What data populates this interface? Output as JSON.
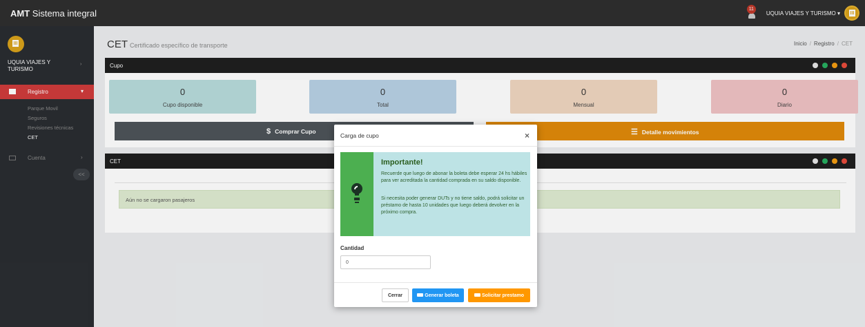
{
  "topbar": {
    "brand_bold": "AMT",
    "brand_rest": " Sistema integral",
    "notif_count": "11",
    "user_name": "UQUIA VIAJES Y TURISMO"
  },
  "sidebar": {
    "user_name": "UQUIA VIAJES Y TURISMO",
    "registro_label": "Registro",
    "sub_items": [
      "Parque Movil",
      "Seguros",
      "Revisiones técnicas",
      "CET"
    ],
    "cuenta_label": "Cuenta",
    "collapse_label": "<<"
  },
  "page": {
    "title": "CET",
    "subtitle": "Certificado específico de transporte",
    "breadcrumb": [
      "Inicio",
      "Registro",
      "CET"
    ]
  },
  "cupo_panel": {
    "title": "Cupo",
    "stats": [
      {
        "value": "0",
        "label": "Cupo disponible",
        "color": "#b8dcdc"
      },
      {
        "value": "0",
        "label": "Total",
        "color": "#b8d1e5"
      },
      {
        "value": "0",
        "label": "Mensual",
        "color": "#f0d6c0"
      },
      {
        "value": "0",
        "label": "Diario",
        "color": "#f0c2c4"
      }
    ],
    "comprar_label": "Comprar Cupo",
    "detalle_label": "Detalle movimientos"
  },
  "cet_panel": {
    "title": "CET",
    "empty_message": "Aún no se cargaron pasajeros"
  },
  "panel_dot_colors": [
    "#e6e6e6",
    "#27ae60",
    "#f39c12",
    "#e74c3c"
  ],
  "modal": {
    "title": "Carga de cupo",
    "close": "×",
    "info_title": "Importante!",
    "info_p1": "Recuerde que luego de abonar la boleta debe esperar 24 hs hábiles para ver acreditada la cantidad comprada en su saldo disponible.",
    "info_p2": "Si necesita poder generar DUTs y no tiene saldo, podrá solicitar un préstamo de hasta 10 unidades que luego deberá devolver en la próximo compra.",
    "cantidad_label": "Cantidad",
    "cantidad_value": "0",
    "btn_cerrar": "Cerrar",
    "btn_generar": "Generar boleta",
    "btn_prestamo": "Solicitar prestamo"
  }
}
